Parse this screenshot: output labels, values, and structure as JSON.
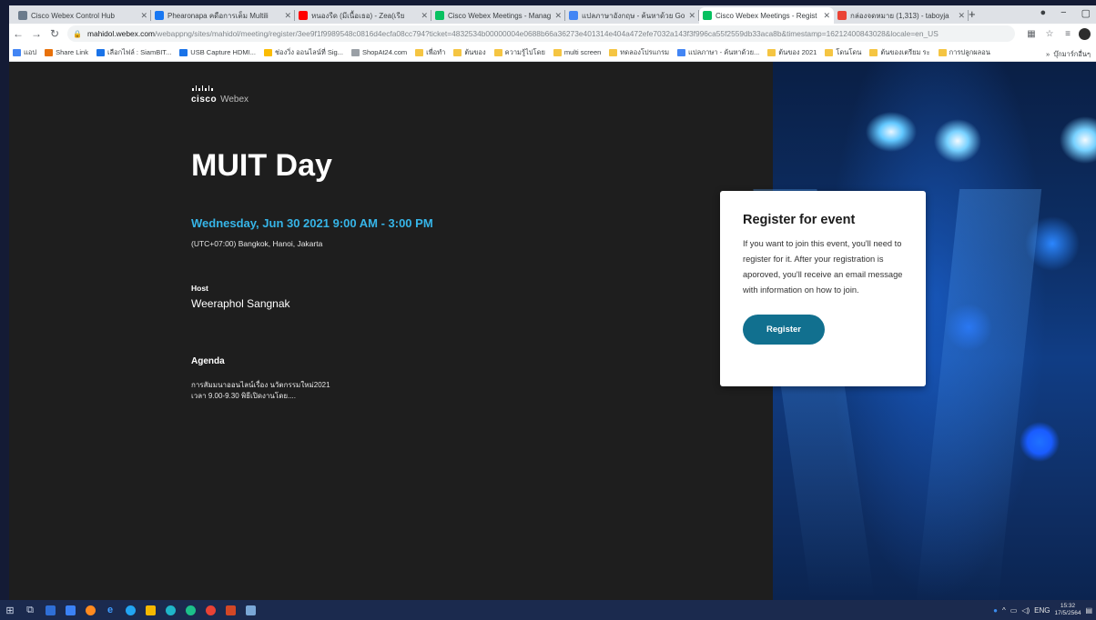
{
  "browser": {
    "tabs": [
      {
        "title": "Cisco Webex Control Hub",
        "fav": "#6b7b8c",
        "active": false
      },
      {
        "title": "Phearonapa คดือการเต็ม Multili",
        "fav": "#1877f2",
        "active": false
      },
      {
        "title": "หนองรีด (มีเนื้อเธอ) - Zea(เรีย",
        "fav": "#ff0000",
        "active": false
      },
      {
        "title": "Cisco Webex Meetings - Manag",
        "fav": "#07c160",
        "active": false
      },
      {
        "title": "แปลภาษาอังกฤษ - ค้นหาด้วย Goo",
        "fav": "#4285f4",
        "active": false
      },
      {
        "title": "Cisco Webex Meetings - Regist",
        "fav": "#07c160",
        "active": true
      },
      {
        "title": "กล่องจดหมาย (1,313) - taboyja",
        "fav": "#ea4335",
        "active": false
      }
    ],
    "new_tab": "+",
    "url_host": "mahidol.webex.com",
    "url_path": "/webappng/sites/mahidol/meeting/register/3ee9f1f9989548c0816d4ecfa08cc794?ticket=4832534b00000004e0688b66a36273e401314e404a472efe7032a143f3f996ca55f2559db33aca8b&timestamp=16212400843028&locale=en_US",
    "bookmarks": [
      {
        "label": "แอป",
        "icon": "#4285f4"
      },
      {
        "label": "Share Link",
        "icon": "#e8710a"
      },
      {
        "label": "เลือกไฟล์ : SiamBIT...",
        "icon": "#1a73e8"
      },
      {
        "label": "USB Capture HDMI...",
        "icon": "#1a73e8"
      },
      {
        "label": "ช่องวิ่ง ออนไลน์ที่ Sig...",
        "icon": "#fbbc04"
      },
      {
        "label": "ShopAt24.com",
        "icon": "#9aa0a6"
      },
      {
        "label": "เพื่อทำ",
        "icon": "folder"
      },
      {
        "label": "ต้นของ",
        "icon": "folder"
      },
      {
        "label": "ความรู้ไปโดย",
        "icon": "folder"
      },
      {
        "label": "multi screen",
        "icon": "folder"
      },
      {
        "label": "ทดลองโปรแกรม",
        "icon": "folder"
      },
      {
        "label": "แปลภาษา - ค้นหาด้วย...",
        "icon": "#4285f4"
      },
      {
        "label": "ต้นของ 2021",
        "icon": "folder"
      },
      {
        "label": "โดนโดน",
        "icon": "folder"
      },
      {
        "label": "ต้นของเตรียม ระ",
        "icon": "folder"
      },
      {
        "label": "การปลูกผลอน",
        "icon": "folder"
      }
    ],
    "bookmarks_more": "»",
    "other_bookmarks": "บุ๊กมาร์กอื่นๆ"
  },
  "logo": {
    "brand": "cisco",
    "product": "Webex"
  },
  "event": {
    "title": "MUIT Day",
    "date": "Wednesday, Jun 30 2021 9:00 AM - 3:00 PM",
    "timezone": "(UTC+07:00) Bangkok, Hanoi, Jakarta",
    "host_label": "Host",
    "host_name": "Weeraphol Sangnak",
    "agenda_label": "Agenda",
    "agenda_lines": [
      "การสัมมนาออนไลน์เรื่อง นวัตกรรมใหม่2021",
      "เวลา 9.00-9.30 พิธีเปิดงานโดย...."
    ]
  },
  "register": {
    "heading": "Register for event",
    "description": "If you want to join this event, you'll need to register for it. After your registration is aporoved, you'll receive an email message with information on how to join.",
    "button_label": "Register",
    "button_color": "#11708f"
  },
  "taskbar": {
    "language": "ENG",
    "time": "15:32",
    "date": "17/5/2564"
  }
}
